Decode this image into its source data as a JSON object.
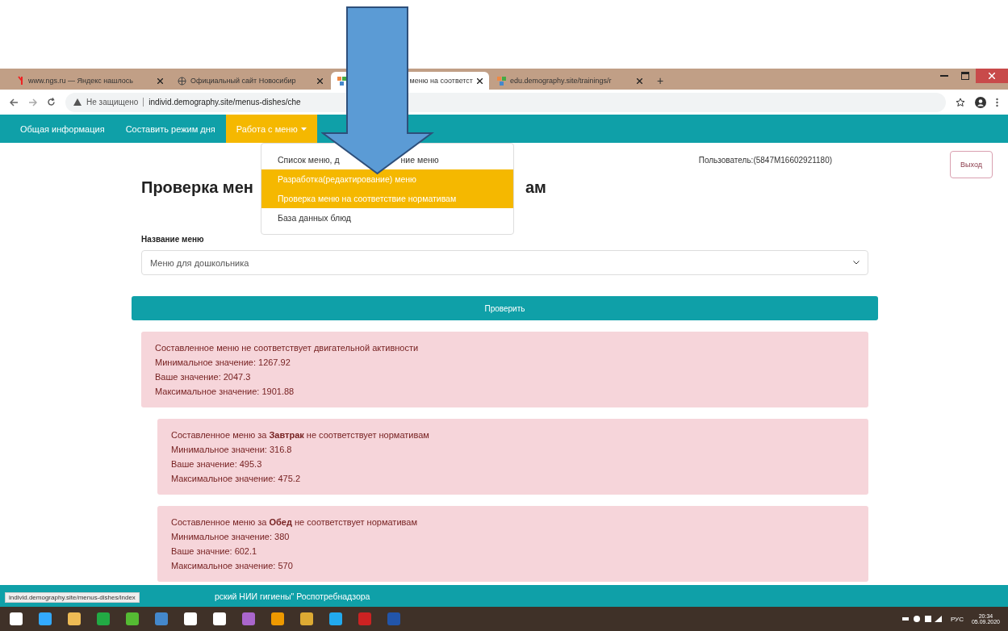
{
  "browser": {
    "tabs": [
      {
        "title": "www.ngs.ru — Яндекс нашлось",
        "selected": false
      },
      {
        "title": "Официальный сайт Новосибир",
        "selected": false
      },
      {
        "title": "меню на соответст",
        "selected": true
      },
      {
        "title": "edu.demography.site/trainings/r",
        "selected": false
      }
    ],
    "new_tab": "+",
    "security": "Не защищено",
    "url": "individ.demography.site/menus-dishes/che"
  },
  "nav": {
    "items": [
      {
        "label": "Общая информация",
        "selected": false,
        "caret": false
      },
      {
        "label": "Составить режим дня",
        "selected": false,
        "caret": false
      },
      {
        "label": "Работа с меню",
        "selected": true,
        "caret": true
      }
    ],
    "dropdown": [
      {
        "parts": [
          "Список меню, д",
          "ние меню"
        ],
        "selected": false
      },
      {
        "parts": [
          "Разработка(редактирование) меню"
        ],
        "selected": true
      },
      {
        "parts": [
          "Проверка меню на соответствие нормативам"
        ],
        "selected": true
      },
      {
        "parts": [
          "База данных блюд"
        ],
        "selected": false
      }
    ]
  },
  "user": "Пользователь:(5847М16602921180)",
  "logout": "Выход",
  "title_parts": [
    "Проверка мен",
    "ам"
  ],
  "menu_label": "Название меню",
  "menu_value": "Меню для дошкольника",
  "check_button": "Проверить",
  "alerts": [
    {
      "nested": false,
      "lines": [
        "Составленное меню не соответствует двигательной активности",
        "Минимальное значение: 1267.92",
        "Ваше значение: 2047.3",
        "Максимальное значение: 1901.88"
      ]
    },
    {
      "nested": true,
      "lines": [
        "Составленное меню за **Завтрак** не соответствует нормативам",
        "Минимальное значени: 316.8",
        "Ваше значение: 495.3",
        "Максимальное значение: 475.2"
      ]
    },
    {
      "nested": true,
      "lines": [
        "Составленное меню за **Обед** не соответствует нормативам",
        "Минимальное значение: 380",
        "Ваше значние: 602.1",
        "Максимальное значение: 570"
      ]
    }
  ],
  "footer": "рский НИИ гигиены\" Роспотребнадзора",
  "status_url": "individ.demography.site/menus-dishes/index",
  "taskbar": {
    "language": "РУС",
    "time": "20:34",
    "date": "05.09.2020"
  }
}
